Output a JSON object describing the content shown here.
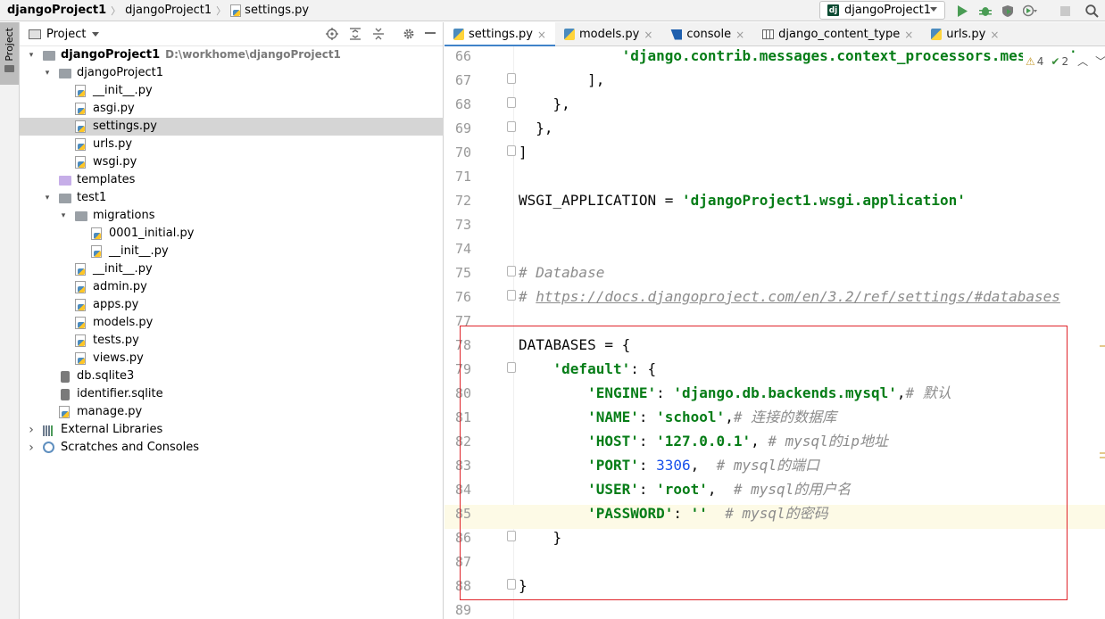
{
  "navbar": {
    "crumbs": [
      "djangoProject1",
      "djangoProject1",
      "settings.py"
    ],
    "run_config": "djangoProject1",
    "run_config_badge": "dj"
  },
  "stripe": {
    "project_label": "Project"
  },
  "project_panel": {
    "title": "Project",
    "tree": [
      {
        "label": "djangoProject1",
        "path": "D:\\workhome\\djangoProject1",
        "kind": "module-folder",
        "depth": 0,
        "expanded": true,
        "bold": true
      },
      {
        "label": "djangoProject1",
        "kind": "package",
        "depth": 1,
        "expanded": true
      },
      {
        "label": "__init__.py",
        "kind": "py",
        "depth": 2
      },
      {
        "label": "asgi.py",
        "kind": "py",
        "depth": 2
      },
      {
        "label": "settings.py",
        "kind": "py",
        "depth": 2,
        "selected": true
      },
      {
        "label": "urls.py",
        "kind": "py",
        "depth": 2
      },
      {
        "label": "wsgi.py",
        "kind": "py",
        "depth": 2
      },
      {
        "label": "templates",
        "kind": "templates-folder",
        "depth": 1
      },
      {
        "label": "test1",
        "kind": "package",
        "depth": 1,
        "expanded": true
      },
      {
        "label": "migrations",
        "kind": "package",
        "depth": 2,
        "expanded": true
      },
      {
        "label": "0001_initial.py",
        "kind": "py",
        "depth": 3
      },
      {
        "label": "__init__.py",
        "kind": "py",
        "depth": 3
      },
      {
        "label": "__init__.py",
        "kind": "py",
        "depth": 2
      },
      {
        "label": "admin.py",
        "kind": "py",
        "depth": 2
      },
      {
        "label": "apps.py",
        "kind": "py",
        "depth": 2
      },
      {
        "label": "models.py",
        "kind": "py",
        "depth": 2
      },
      {
        "label": "tests.py",
        "kind": "py",
        "depth": 2
      },
      {
        "label": "views.py",
        "kind": "py",
        "depth": 2
      },
      {
        "label": "db.sqlite3",
        "kind": "db",
        "depth": 1
      },
      {
        "label": "identifier.sqlite",
        "kind": "db",
        "depth": 1
      },
      {
        "label": "manage.py",
        "kind": "py",
        "depth": 1
      },
      {
        "label": "External Libraries",
        "kind": "libs",
        "depth": 0,
        "expanded": false
      },
      {
        "label": "Scratches and Consoles",
        "kind": "scratch",
        "depth": 0,
        "expanded": false
      }
    ]
  },
  "tabs": [
    {
      "label": "settings.py",
      "icon": "python-file-icon",
      "active": true
    },
    {
      "label": "models.py",
      "icon": "python-file-icon"
    },
    {
      "label": "console",
      "icon": "console-icon"
    },
    {
      "label": "django_content_type",
      "icon": "table-icon"
    },
    {
      "label": "urls.py",
      "icon": "python-file-icon"
    }
  ],
  "inspection": {
    "warnings": "4",
    "ok": "2"
  },
  "editor": {
    "lines": [
      {
        "n": "66",
        "html": "            <span class=\"s\">'django.contrib.messages.context_processors.messages'</span>,"
      },
      {
        "n": "67",
        "html": "        ],",
        "fold": true
      },
      {
        "n": "68",
        "html": "    },",
        "fold": true
      },
      {
        "n": "69",
        "html": "  },",
        "fold": true
      },
      {
        "n": "70",
        "html": "]",
        "fold": true
      },
      {
        "n": "71",
        "html": ""
      },
      {
        "n": "72",
        "html": "WSGI_APPLICATION = <span class=\"s\">'djangoProject1.wsgi.application'</span>"
      },
      {
        "n": "73",
        "html": ""
      },
      {
        "n": "74",
        "html": ""
      },
      {
        "n": "75",
        "html": "<span class=\"c\"># Database</span>",
        "fold": true
      },
      {
        "n": "76",
        "html": "<span class=\"c\"># </span><span class=\"u\">https://docs.djangoproject.com/en/3.2/ref/settings/#databases</span>",
        "fold": true
      },
      {
        "n": "77",
        "html": ""
      },
      {
        "n": "78",
        "html": "DATABASES = {"
      },
      {
        "n": "79",
        "html": "    <span class=\"s\">'default'</span>: {",
        "fold": true
      },
      {
        "n": "80",
        "html": "        <span class=\"s\">'ENGINE'</span>: <span class=\"s\">'django.db.backends.mysql'</span>,<span class=\"c\"># 默认</span>"
      },
      {
        "n": "81",
        "html": "        <span class=\"s\">'NAME'</span>: <span class=\"s\">'school'</span>,<span class=\"c\"># 连接的数据库</span>"
      },
      {
        "n": "82",
        "html": "        <span class=\"s\">'HOST'</span>: <span class=\"s\">'127.0.0.1'</span>, <span class=\"c\"># mysql的ip地址</span>"
      },
      {
        "n": "83",
        "html": "        <span class=\"s\">'PORT'</span>: <span class=\"n\">3306</span>,  <span class=\"c\"># mysql的端口</span>"
      },
      {
        "n": "84",
        "html": "        <span class=\"s\">'USER'</span>: <span class=\"s\">'root'</span>,  <span class=\"c\"># mysql的用户名</span>"
      },
      {
        "n": "85",
        "html": "        <span class=\"s\">'PASSWORD'</span>: <span class=\"s\">''</span>  <span class=\"c\"># mysql的密码</span>",
        "current": true
      },
      {
        "n": "86",
        "html": "    }",
        "fold": true
      },
      {
        "n": "87",
        "html": ""
      },
      {
        "n": "88",
        "html": "}",
        "fold": true
      },
      {
        "n": "89",
        "html": ""
      }
    ]
  }
}
